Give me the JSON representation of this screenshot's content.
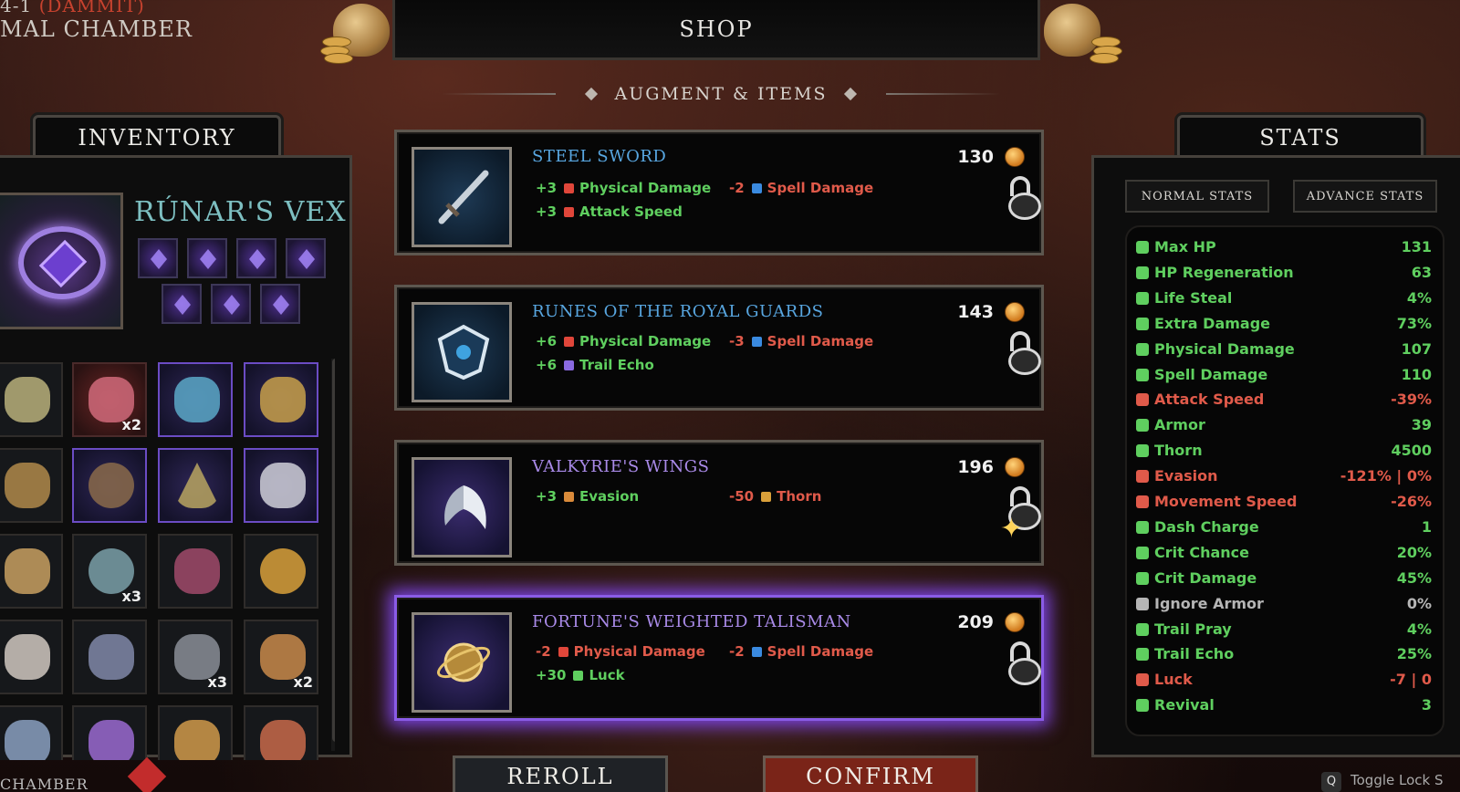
{
  "location": {
    "line1_prefix": "4-1",
    "line1_red": "(DAMMIT)",
    "line2": "MAL CHAMBER"
  },
  "shop": {
    "title": "SHOP",
    "subtitle": "AUGMENT & ITEMS"
  },
  "inventory": {
    "title": "INVENTORY",
    "hero_name": "RÚNAR'S VEX",
    "quantities": {
      "slot_1": "x2",
      "slot_9": "x3",
      "slot_14": "x3",
      "slot_15": "x2"
    }
  },
  "items": [
    {
      "name": "STEEL SWORD",
      "price": "130",
      "stats": [
        {
          "value": "+3",
          "label": "Physical Damage",
          "type": "pos",
          "icon": "physical-damage-icon"
        },
        {
          "value": "-2",
          "label": "Spell Damage",
          "type": "neg",
          "icon": "spell-damage-icon"
        },
        {
          "value": "+3",
          "label": "Attack Speed",
          "type": "pos",
          "icon": "attack-speed-icon"
        }
      ]
    },
    {
      "name": "RUNES OF THE ROYAL GUARDS",
      "price": "143",
      "stats": [
        {
          "value": "+6",
          "label": "Physical Damage",
          "type": "pos",
          "icon": "physical-damage-icon"
        },
        {
          "value": "-3",
          "label": "Spell Damage",
          "type": "neg",
          "icon": "spell-damage-icon"
        },
        {
          "value": "+6",
          "label": "Trail Echo",
          "type": "pos",
          "icon": "trail-echo-icon"
        }
      ]
    },
    {
      "name": "VALKYRIE'S WINGS",
      "price": "196",
      "stats": [
        {
          "value": "+3",
          "label": "Evasion",
          "type": "pos",
          "icon": "evasion-icon"
        },
        {
          "value": "-50",
          "label": "Thorn",
          "type": "neg",
          "icon": "thorn-icon"
        }
      ]
    },
    {
      "name": "FORTUNE'S WEIGHTED TALISMAN",
      "price": "209",
      "stats": [
        {
          "value": "-2",
          "label": "Physical Damage",
          "type": "neg",
          "icon": "physical-damage-icon"
        },
        {
          "value": "-2",
          "label": "Spell Damage",
          "type": "neg",
          "icon": "spell-damage-icon"
        },
        {
          "value": "+30",
          "label": "Luck",
          "type": "pos",
          "icon": "luck-icon"
        }
      ]
    }
  ],
  "buttons": {
    "reroll": "REROLL",
    "confirm": "CONFIRM"
  },
  "stats": {
    "title": "STATS",
    "tabs": [
      "NORMAL STATS",
      "ADVANCE STATS"
    ],
    "rows": [
      {
        "label": "Max HP",
        "value": "131",
        "color": "#5fcf5f"
      },
      {
        "label": "HP Regeneration",
        "value": "63",
        "color": "#5fcf5f"
      },
      {
        "label": "Life Steal",
        "value": "4%",
        "color": "#5fcf5f"
      },
      {
        "label": "Extra Damage",
        "value": "73%",
        "color": "#5fcf5f"
      },
      {
        "label": "Physical Damage",
        "value": "107",
        "color": "#5fcf5f"
      },
      {
        "label": "Spell Damage",
        "value": "110",
        "color": "#5fcf5f"
      },
      {
        "label": "Attack Speed",
        "value": "-39%",
        "color": "#e05a4a"
      },
      {
        "label": "Armor",
        "value": "39",
        "color": "#5fcf5f"
      },
      {
        "label": "Thorn",
        "value": "4500",
        "color": "#5fcf5f"
      },
      {
        "label": "Evasion",
        "value": "-121% | 0%",
        "color": "#e05a4a"
      },
      {
        "label": "Movement Speed",
        "value": "-26%",
        "color": "#e05a4a"
      },
      {
        "label": "Dash Charge",
        "value": "1",
        "color": "#5fcf5f"
      },
      {
        "label": "Crit Chance",
        "value": "20%",
        "color": "#5fcf5f"
      },
      {
        "label": "Crit Damage",
        "value": "45%",
        "color": "#5fcf5f"
      },
      {
        "label": "Ignore Armor",
        "value": "0%",
        "color": "#b5b5b5"
      },
      {
        "label": "Trail Pray",
        "value": "4%",
        "color": "#5fcf5f"
      },
      {
        "label": "Trail Echo",
        "value": "25%",
        "color": "#5fcf5f"
      },
      {
        "label": "Luck",
        "value": "-7 | 0",
        "color": "#e05a4a"
      },
      {
        "label": "Revival",
        "value": "3",
        "color": "#5fcf5f"
      }
    ]
  },
  "hint": {
    "key": "Q",
    "text": "Toggle Lock S"
  },
  "bottom_left": "CHAMBER"
}
